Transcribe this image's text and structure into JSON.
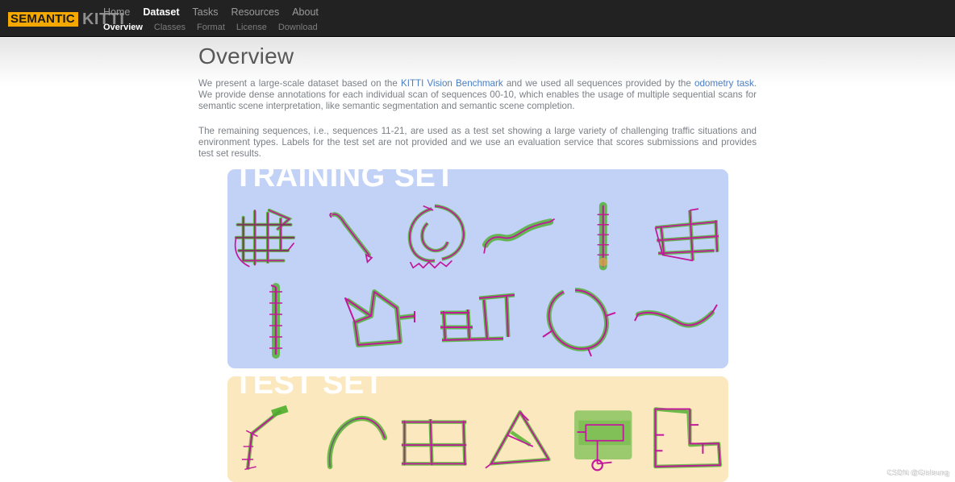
{
  "brand": {
    "semantic": "SEMANTIC",
    "kitti": "KITTI"
  },
  "nav": {
    "primary": [
      {
        "label": "Home",
        "active": false
      },
      {
        "label": "Dataset",
        "active": true
      },
      {
        "label": "Tasks",
        "active": false
      },
      {
        "label": "Resources",
        "active": false
      },
      {
        "label": "About",
        "active": false
      }
    ],
    "secondary": [
      {
        "label": "Overview",
        "active": true
      },
      {
        "label": "Classes",
        "active": false
      },
      {
        "label": "Format",
        "active": false
      },
      {
        "label": "License",
        "active": false
      },
      {
        "label": "Download",
        "active": false
      }
    ]
  },
  "main": {
    "title": "Overview",
    "paragraph1": {
      "part1": "We present a large-scale dataset based on the ",
      "link1": "KITTI Vision Benchmark",
      "part2": " and we used all sequences provided by the ",
      "link2": "odometry task",
      "part3": ". We provide dense annotations for each individual scan of sequences 00-10, which enables the usage of multiple sequential scans for semantic scene interpretation, like semantic segmentation and semantic scene completion."
    },
    "paragraph2": "The remaining sequences, i.e., sequences 11-21, are used as a test set showing a large variety of challenging traffic situations and environment types. Labels for the test set are not provided and we use an evaluation service that scores submissions and provides test set results."
  },
  "panels": {
    "training": {
      "label": "TRAINING SET",
      "background_color": "#c2d2f7",
      "sequence_count": 11
    },
    "test": {
      "label": "TEST SET",
      "background_color": "#fbe8bf",
      "sequence_count": 6
    }
  },
  "colors": {
    "navbar": "#222222",
    "brand_highlight": "#f5a800",
    "link": "#4b7ec0",
    "body_text": "#7a7f85",
    "title": "#585858",
    "trajectory_path": "#c2189b",
    "trajectory_vegetation": "#4caf2a"
  },
  "watermark": {
    "text": "CSDN @Gisleung"
  }
}
